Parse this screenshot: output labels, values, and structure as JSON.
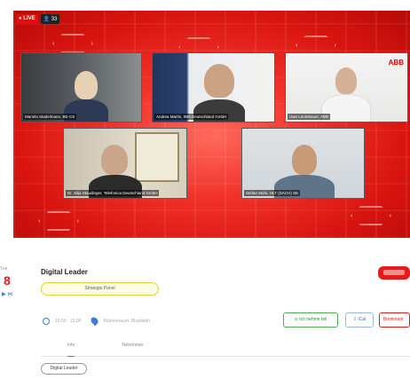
{
  "stream": {
    "live_label": "● LIVE",
    "viewer_count": "33",
    "participants": [
      {
        "name": "Mariela Stadelmann, BE-CS"
      },
      {
        "name": "Andrea Martin, IBM Deutschland GmbH"
      },
      {
        "name": "Uwe Leutebauer, ABB"
      },
      {
        "name": "Dr. Silja Staudinger, Telefonica Deutschland GmbH"
      },
      {
        "name": "Stefan Mohr, HLT (DACH) SE"
      }
    ],
    "logo_text": "ABB"
  },
  "event": {
    "day_label": "Tue",
    "day_number": "8",
    "title": "Digital Leader",
    "category_button": "Strategie Panel",
    "time": "15:00 - 15:00",
    "location": "Bühnenraum: Bluebbdn",
    "actions": {
      "attend": "Ich nehme teil",
      "ical": "iCal",
      "remove": "Bookmark"
    },
    "tabs": [
      "Info",
      "Teilnehmer"
    ],
    "tag_chip": "Digital Leader"
  },
  "colors": {
    "stage_red": "#e8201a",
    "live_red": "#e01010",
    "accent_blue": "#3a7bd5",
    "green": "#4caf50"
  }
}
